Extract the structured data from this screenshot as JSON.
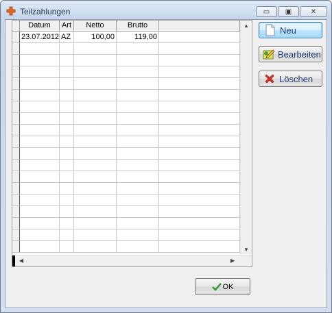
{
  "window": {
    "title": "Teilzahlungen"
  },
  "caption": {
    "minimize": "▭",
    "restore": "▣",
    "close": "✕"
  },
  "grid": {
    "columns": [
      "Datum",
      "Art",
      "Netto",
      "Brutto",
      ""
    ],
    "rows": [
      [
        "23.07.2012",
        "AZ",
        "100,00",
        "119,00",
        ""
      ]
    ],
    "empty_row_count": 18
  },
  "buttons": {
    "new_label": "Neu",
    "edit_label": "Bearbeiten",
    "delete_label": "Löschen",
    "ok_label": "OK"
  },
  "scroll": {
    "up": "▲",
    "down": "▼",
    "left": "◀",
    "right": "▶"
  }
}
